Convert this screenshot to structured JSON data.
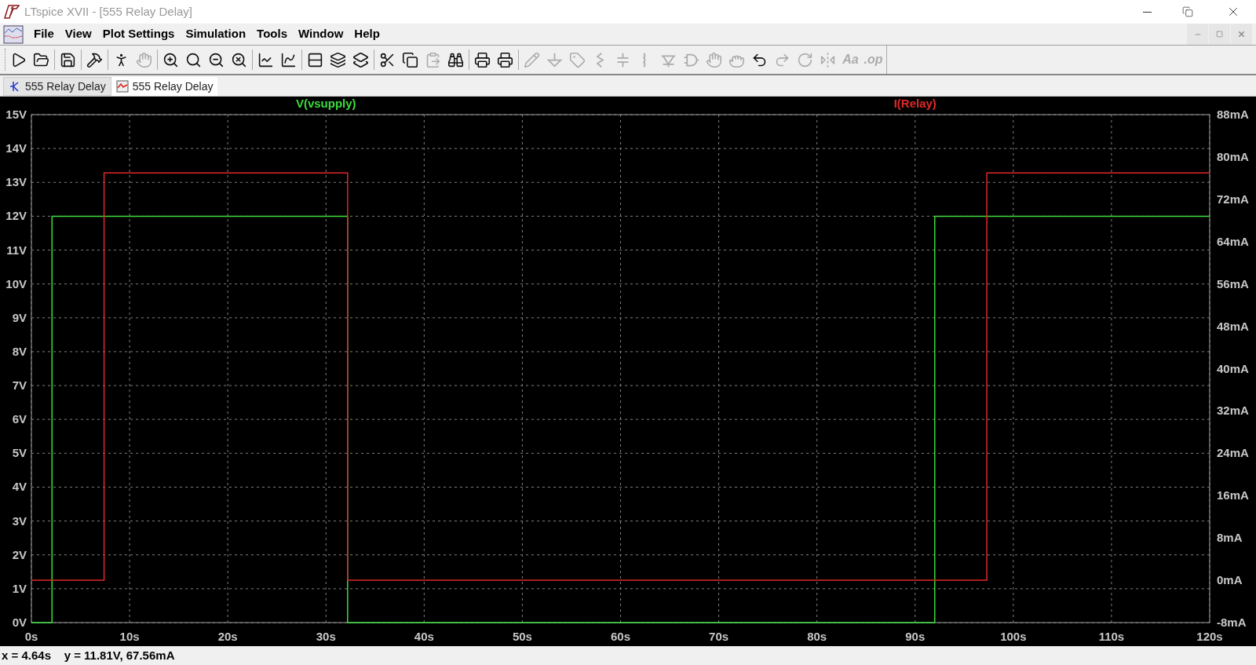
{
  "window": {
    "title": "LTspice XVII - [555 Relay Delay]"
  },
  "menu": [
    "File",
    "View",
    "Plot Settings",
    "Simulation",
    "Tools",
    "Window",
    "Help"
  ],
  "toolbar": [
    {
      "disabled": false
    },
    {
      "disabled": false
    },
    {
      "disabled": false
    },
    {
      "disabled": false
    },
    {
      "disabled": false
    },
    {
      "disabled": true
    },
    {
      "disabled": false
    },
    {
      "disabled": false
    },
    {
      "disabled": false
    },
    {
      "disabled": false
    },
    {
      "disabled": false
    },
    {
      "disabled": false
    },
    {
      "disabled": false
    },
    {
      "disabled": false
    },
    {
      "disabled": false
    },
    {
      "disabled": false
    },
    {
      "disabled": false
    },
    {
      "disabled": true
    },
    {
      "disabled": false
    },
    {
      "disabled": false
    },
    {
      "disabled": false
    },
    {
      "disabled": true
    },
    {
      "disabled": true
    },
    {
      "disabled": true
    },
    {
      "disabled": true
    },
    {
      "disabled": true
    },
    {
      "disabled": true
    },
    {
      "disabled": true
    },
    {
      "disabled": true
    },
    {
      "disabled": true
    },
    {
      "disabled": true
    },
    {
      "disabled": false
    },
    {
      "disabled": true
    },
    {
      "disabled": true
    },
    {
      "disabled": true
    },
    {
      "disabled": true,
      "label": "Aa"
    },
    {
      "disabled": true,
      "label": ".op"
    }
  ],
  "tabs": [
    {
      "label": "555 Relay Delay",
      "selected": false
    },
    {
      "label": "555 Relay Delay",
      "selected": true
    }
  ],
  "plot": {
    "chart_data": {
      "type": "line",
      "x": [
        0,
        2.1,
        2.1,
        7.4,
        7.4,
        32.2,
        32.2,
        92,
        92,
        97.3,
        97.3,
        120
      ],
      "grid": true,
      "series": [
        {
          "name": "V(vsupply)",
          "color": "#3ddc3d",
          "values": [
            0,
            0,
            12,
            12,
            12,
            12,
            0,
            0,
            12,
            12,
            12,
            12
          ]
        },
        {
          "name": "I(Relay)",
          "axis": "y2",
          "color": "#e02828",
          "values": [
            0,
            0,
            0,
            0,
            77,
            77,
            0,
            0,
            0,
            0,
            77,
            77
          ]
        }
      ],
      "xlim": [
        0,
        120
      ],
      "ylim": [
        0,
        15
      ],
      "xticks": [
        {
          "value": 0,
          "label": "0s"
        },
        {
          "value": 10,
          "label": "10s"
        },
        {
          "value": 20,
          "label": "20s"
        },
        {
          "value": 30,
          "label": "30s"
        },
        {
          "value": 40,
          "label": "40s"
        },
        {
          "value": 50,
          "label": "50s"
        },
        {
          "value": 60,
          "label": "60s"
        },
        {
          "value": 70,
          "label": "70s"
        },
        {
          "value": 80,
          "label": "80s"
        },
        {
          "value": 90,
          "label": "90s"
        },
        {
          "value": 100,
          "label": "100s"
        },
        {
          "value": 110,
          "label": "110s"
        },
        {
          "value": 120,
          "label": "120s"
        }
      ],
      "yticks": [
        {
          "value": 0,
          "label": "0V"
        },
        {
          "value": 1,
          "label": "1V"
        },
        {
          "value": 2,
          "label": "2V"
        },
        {
          "value": 3,
          "label": "3V"
        },
        {
          "value": 4,
          "label": "4V"
        },
        {
          "value": 5,
          "label": "5V"
        },
        {
          "value": 6,
          "label": "6V"
        },
        {
          "value": 7,
          "label": "7V"
        },
        {
          "value": 8,
          "label": "8V"
        },
        {
          "value": 9,
          "label": "9V"
        },
        {
          "value": 10,
          "label": "10V"
        },
        {
          "value": 11,
          "label": "11V"
        },
        {
          "value": 12,
          "label": "12V"
        },
        {
          "value": 13,
          "label": "13V"
        },
        {
          "value": 14,
          "label": "14V"
        },
        {
          "value": 15,
          "label": "15V"
        }
      ],
      "y2lim": [
        -8,
        88
      ],
      "y2ticks": [
        {
          "value": -8,
          "label": "-8mA"
        },
        {
          "value": 0,
          "label": "0mA"
        },
        {
          "value": 8,
          "label": "8mA"
        },
        {
          "value": 16,
          "label": "16mA"
        },
        {
          "value": 24,
          "label": "24mA"
        },
        {
          "value": 32,
          "label": "32mA"
        },
        {
          "value": 40,
          "label": "40mA"
        },
        {
          "value": 48,
          "label": "48mA"
        },
        {
          "value": 56,
          "label": "56mA"
        },
        {
          "value": 64,
          "label": "64mA"
        },
        {
          "value": 72,
          "label": "72mA"
        },
        {
          "value": 80,
          "label": "80mA"
        },
        {
          "value": 88,
          "label": "88mA"
        }
      ]
    }
  },
  "status_bar": "x = 4.64s    y = 11.81V, 67.56mA"
}
